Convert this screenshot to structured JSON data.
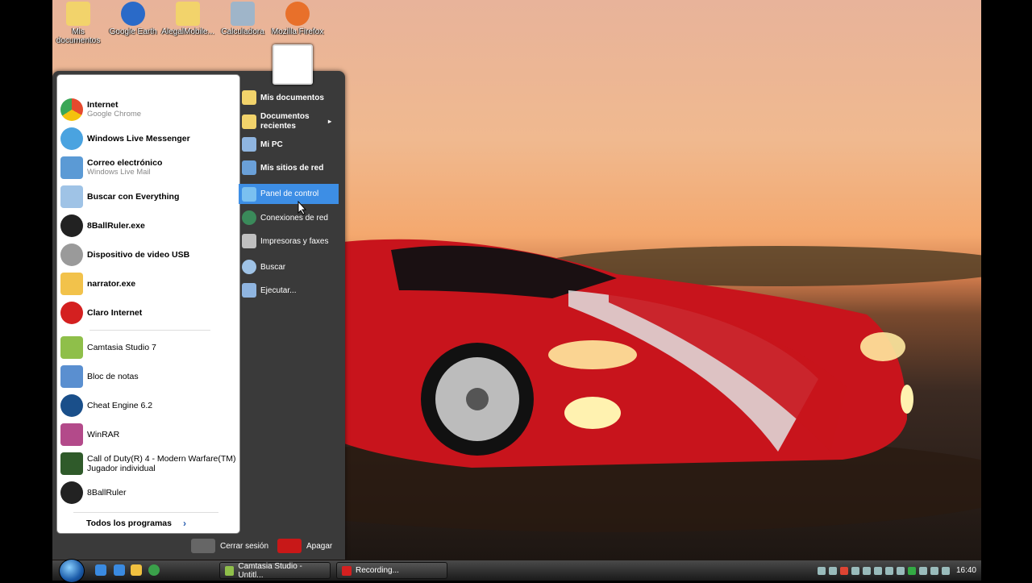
{
  "desktop_icons": [
    {
      "label": "Mis documentos",
      "icon": "folder-documents-icon",
      "color": "#f2d36b"
    },
    {
      "label": "Google Earth",
      "icon": "google-earth-icon",
      "color": "#2a6ac8"
    },
    {
      "label": "AlegalMobile...",
      "icon": "folder-icon",
      "color": "#f2d36b"
    },
    {
      "label": "Calculadora",
      "icon": "calculator-icon",
      "color": "#9fb5c9"
    },
    {
      "label": "Mozilla Firefox",
      "icon": "firefox-icon",
      "color": "#e8702a"
    }
  ],
  "start_menu": {
    "pinned": [
      {
        "title": "Internet",
        "subtitle": "Google Chrome",
        "icon": "chrome-icon",
        "color": "#e64a2e"
      },
      {
        "title": "Windows Live Messenger",
        "subtitle": "",
        "icon": "messenger-icon",
        "color": "#4aa3e0"
      },
      {
        "title": "Correo electrónico",
        "subtitle": "Windows Live Mail",
        "icon": "mail-icon",
        "color": "#5b9ad5"
      },
      {
        "title": "Buscar con Everything",
        "subtitle": "",
        "icon": "search-everything-icon",
        "color": "#9fc3e6"
      }
    ],
    "recent_bold": [
      {
        "title": "8BallRuler.exe",
        "icon": "8ball-icon",
        "color": "#222222"
      },
      {
        "title": "Dispositivo de video USB",
        "icon": "webcam-icon",
        "color": "#9a9a9a"
      },
      {
        "title": "narrator.exe",
        "icon": "narrator-icon",
        "color": "#f2c24b"
      },
      {
        "title": "Claro Internet",
        "icon": "claro-icon",
        "color": "#d42020"
      }
    ],
    "recent": [
      {
        "title": "Camtasia Studio 7",
        "subtitle": "",
        "icon": "camtasia-icon",
        "color": "#8fbf4a"
      },
      {
        "title": "Bloc de notas",
        "subtitle": "",
        "icon": "notepad-icon",
        "color": "#5a8fd0"
      },
      {
        "title": "Cheat Engine 6.2",
        "subtitle": "",
        "icon": "cheat-engine-icon",
        "color": "#1a4f8a"
      },
      {
        "title": "WinRAR",
        "subtitle": "",
        "icon": "winrar-icon",
        "color": "#b34a8a"
      },
      {
        "title": "Call of Duty(R) 4 - Modern Warfare(TM)",
        "subtitle": "Jugador individual",
        "icon": "cod4-icon",
        "color": "#2f5a2a"
      },
      {
        "title": "8BallRuler",
        "subtitle": "",
        "icon": "8ball-icon",
        "color": "#222222"
      }
    ],
    "all_programs": "Todos los programas",
    "right": [
      {
        "label": "Mis documentos",
        "icon": "folder-documents-icon",
        "color": "#f2d36b",
        "bold": true
      },
      {
        "label": "Documentos recientes",
        "icon": "folder-recent-icon",
        "color": "#f2d36b",
        "bold": true
      },
      {
        "label": "Mi PC",
        "icon": "computer-icon",
        "color": "#8fb5e0",
        "bold": true
      },
      {
        "label": "Mis sitios de red",
        "icon": "network-places-icon",
        "color": "#6aa0d8",
        "bold": true
      },
      {
        "label": "Panel de control",
        "icon": "control-panel-icon",
        "color": "#7ac0f0",
        "bold": false
      },
      {
        "label": "Conexiones de red",
        "icon": "network-connections-icon",
        "color": "#3a8a5a",
        "bold": false
      },
      {
        "label": "Impresoras y faxes",
        "icon": "printer-icon",
        "color": "#c0c0c0",
        "bold": false
      },
      {
        "label": "Buscar",
        "icon": "search-icon",
        "color": "#9fc3e6",
        "bold": false
      },
      {
        "label": "Ejecutar...",
        "icon": "run-icon",
        "color": "#8fb5e0",
        "bold": false
      }
    ],
    "logoff": "Cerrar sesión",
    "shutdown": "Apagar"
  },
  "taskbar": {
    "quick_launch": [
      {
        "icon": "ie-icon",
        "color": "#3a8ae0"
      },
      {
        "icon": "show-desktop-icon",
        "color": "#f0c040"
      },
      {
        "icon": "utorrent-icon",
        "color": "#3aa04a"
      }
    ],
    "buttons": [
      {
        "label": "Camtasia Studio - Untitl...",
        "icon": "camtasia-icon",
        "color": "#8fbf4a"
      },
      {
        "label": "Recording...",
        "icon": "record-icon",
        "color": "#d42020"
      }
    ],
    "clock": "16:40"
  }
}
